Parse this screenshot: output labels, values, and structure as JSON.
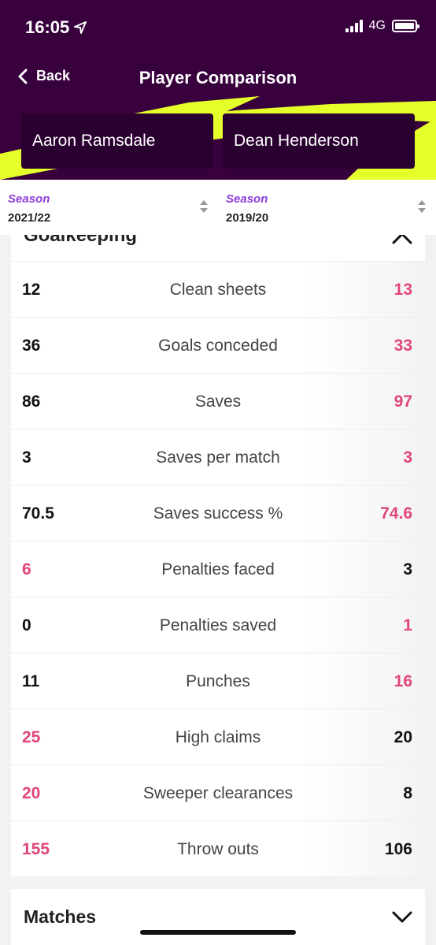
{
  "status_bar": {
    "time": "16:05",
    "network": "4G"
  },
  "nav": {
    "back_label": "Back",
    "title": "Player Comparison"
  },
  "players": {
    "left": "Aaron Ramsdale",
    "right": "Dean Henderson"
  },
  "seasons": {
    "left": {
      "label": "Season",
      "value": "2021/22"
    },
    "right": {
      "label": "Season",
      "value": "2019/20"
    }
  },
  "section": {
    "title": "Goalkeeping"
  },
  "stats": [
    {
      "label": "Clean sheets",
      "left": "12",
      "right": "13"
    },
    {
      "label": "Goals conceded",
      "left": "36",
      "right": "33"
    },
    {
      "label": "Saves",
      "left": "86",
      "right": "97"
    },
    {
      "label": "Saves per match",
      "left": "3",
      "right": "3"
    },
    {
      "label": "Saves success %",
      "left": "70.5",
      "right": "74.6"
    },
    {
      "label": "Penalties faced",
      "left": "6",
      "right": "3"
    },
    {
      "label": "Penalties saved",
      "left": "0",
      "right": "1"
    },
    {
      "label": "Punches",
      "left": "11",
      "right": "16"
    },
    {
      "label": "High claims",
      "left": "25",
      "right": "20"
    },
    {
      "label": "Sweeper clearances",
      "left": "20",
      "right": "8"
    },
    {
      "label": "Throw outs",
      "left": "155",
      "right": "106"
    }
  ],
  "highlight_side": [
    "right",
    "right",
    "right",
    "right",
    "right",
    "left",
    "right",
    "right",
    "left",
    "left",
    "left"
  ],
  "matches": {
    "title": "Matches"
  },
  "colors": {
    "header": "#38003c",
    "accent": "#e0457b",
    "neon": "#e5ff2b",
    "season_label": "#8c3cdc"
  }
}
